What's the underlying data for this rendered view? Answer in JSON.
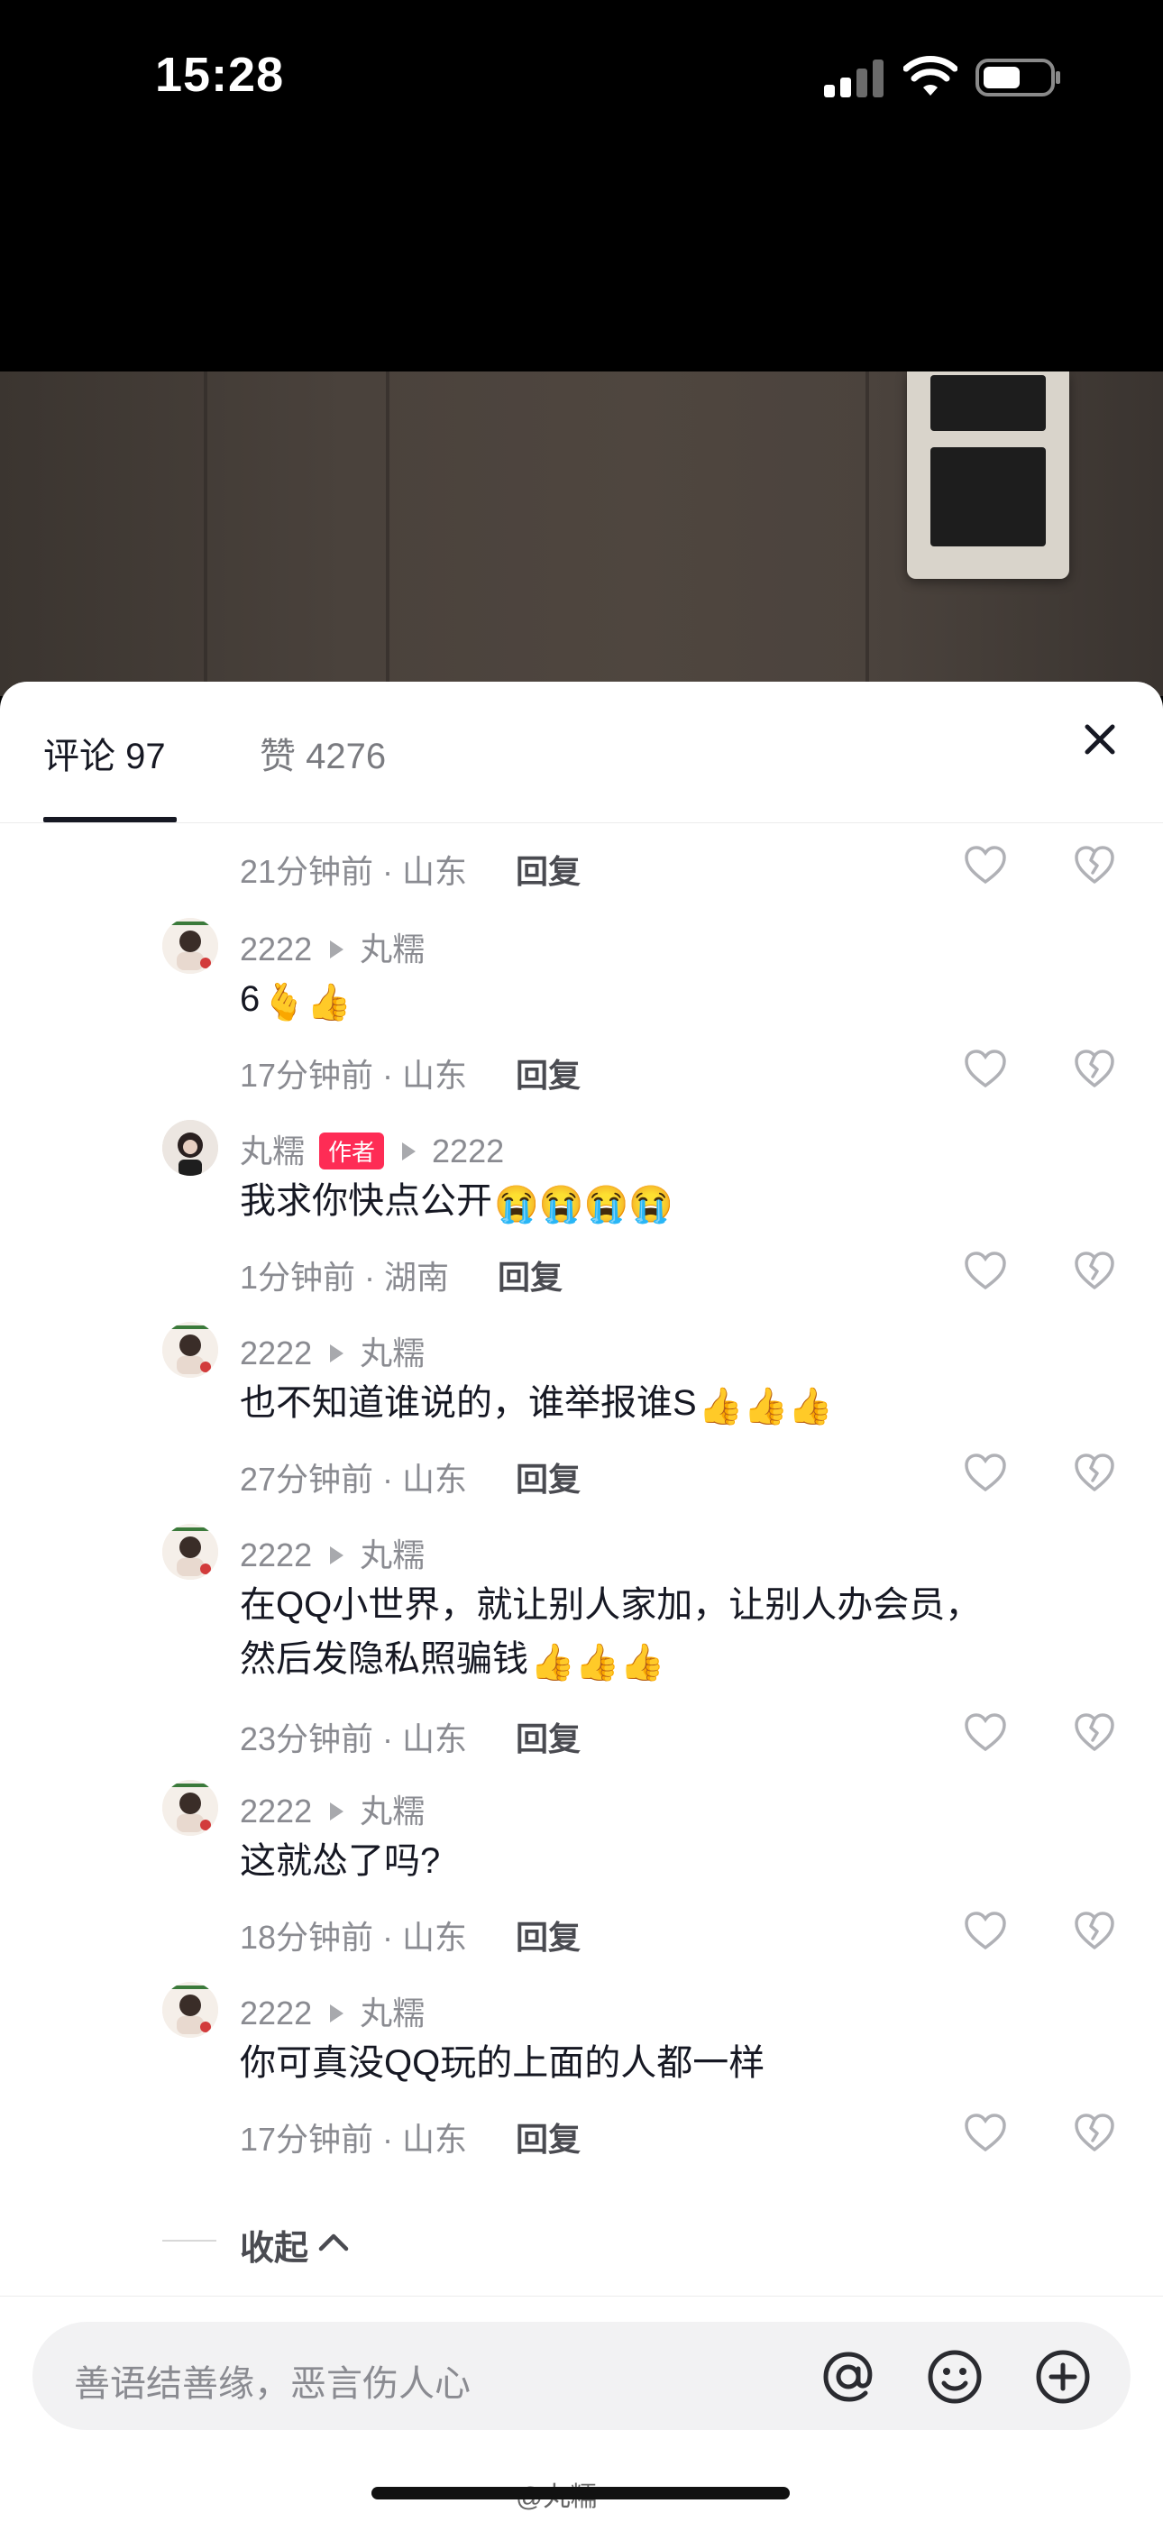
{
  "status_bar": {
    "time": "15:28"
  },
  "tabs": {
    "comments_label": "评论 97",
    "likes_label": "赞 4276"
  },
  "comments": [
    {
      "meta": "",
      "text": "",
      "time_loc": "21分钟前 · 山东",
      "reply": "回复"
    },
    {
      "user": "2222",
      "reply_to": "丸糯",
      "text": "6",
      "emojis": "🫰👍",
      "time_loc": "17分钟前 · 山东",
      "reply": "回复"
    },
    {
      "user": "丸糯",
      "badge": "作者",
      "reply_to": "2222",
      "text": "我求你快点公开",
      "emojis": "😭😭😭😭",
      "time_loc": "1分钟前 · 湖南",
      "reply": "回复"
    },
    {
      "user": "2222",
      "reply_to": "丸糯",
      "text": "也不知道谁说的，谁举报谁S",
      "emojis": "👍👍👍",
      "time_loc": "27分钟前 · 山东",
      "reply": "回复"
    },
    {
      "user": "2222",
      "reply_to": "丸糯",
      "text_line1": "在QQ小世界，就让别人家加，让别人办会员，",
      "text_line2": "然后发隐私照骗钱",
      "emojis": "👍👍👍",
      "time_loc": "23分钟前 · 山东",
      "reply": "回复"
    },
    {
      "user": "2222",
      "reply_to": "丸糯",
      "text": "这就怂了吗?",
      "time_loc": "18分钟前 · 山东",
      "reply": "回复"
    },
    {
      "user": "2222",
      "reply_to": "丸糯",
      "text": "你可真没QQ玩的上面的人都一样",
      "time_loc": "17分钟前 · 山东",
      "reply": "回复"
    }
  ],
  "collapse_label": "收起",
  "input": {
    "placeholder": "善语结善缘，恶言伤人心"
  },
  "watermark": "@丸糯",
  "colors": {
    "accent": "#fe2c55",
    "text": "#161823",
    "muted": "#8a8b91"
  }
}
